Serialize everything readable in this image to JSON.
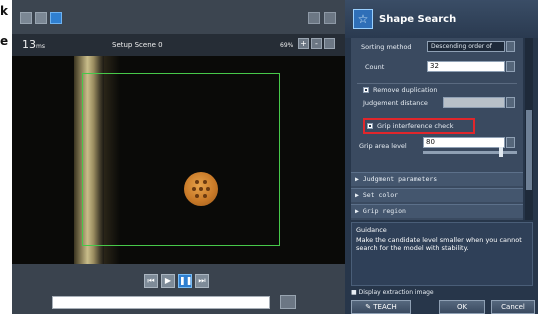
{
  "stray_text": [
    "k",
    "e"
  ],
  "viewer": {
    "time_value": "13",
    "time_unit": "ms",
    "scene": "Setup Scene 0",
    "zoom": "69%",
    "zoom_in_icon": "+",
    "zoom_out_icon": "-",
    "filename_value": ""
  },
  "panel": {
    "title": "Shape Search",
    "sorting_method_label": "Sorting method",
    "sorting_method_value": "Descending order of",
    "count_label": "Count",
    "count_value": "32",
    "remove_duplication_label": "Remove duplication",
    "judgement_distance_label": "Judgement distance",
    "judgement_distance_value": "",
    "grip_interference_label": "Grip interference check",
    "grip_area_level_label": "Grip area level",
    "grip_area_level_value": "80",
    "grip_area_level_slider": 0.8,
    "sections": [
      "Judgment parameters",
      "Set color",
      "Grip region"
    ],
    "section_arrow": "▶",
    "guidance_title": "Guidance",
    "guidance_text": "Make the candidate level smaller when you cannot search for the model with stability.",
    "display_extraction_label": "Display extraction image",
    "teach_label": "TEACH",
    "ok_label": "OK",
    "cancel_label": "Cancel"
  },
  "colors": {
    "roi": "#47c84a",
    "highlight": "#e0262b",
    "active_button": "#2f7fd0"
  }
}
